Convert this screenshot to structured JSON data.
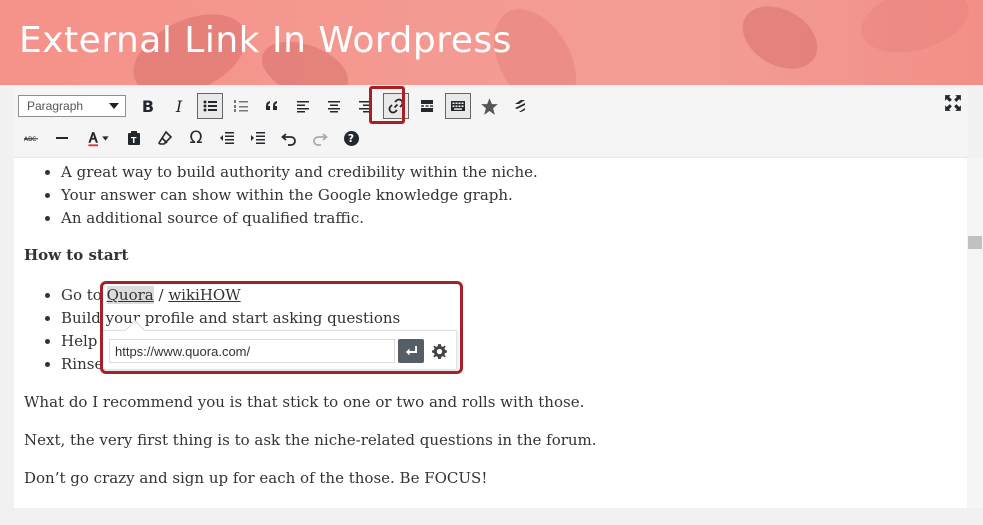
{
  "banner": {
    "title": "External Link In Wordpress"
  },
  "toolbar": {
    "format_select": "Paragraph",
    "row1_icons": [
      "bold-icon",
      "italic-icon",
      "bullet-list-icon",
      "numbered-list-icon",
      "blockquote-icon",
      "align-left-icon",
      "align-center-icon",
      "align-right-icon",
      "link-icon",
      "read-more-icon",
      "toolbar-toggle-icon",
      "star-icon",
      "plugin-icon"
    ],
    "row2_icons": [
      "strikethrough-icon",
      "horizontal-line-icon",
      "text-color-icon",
      "paste-text-icon",
      "clear-formatting-icon",
      "special-character-icon",
      "outdent-icon",
      "indent-icon",
      "undo-icon",
      "redo-icon",
      "help-icon"
    ],
    "bold": "B",
    "italic": "I",
    "omega": "Ω",
    "help": "?"
  },
  "content": {
    "list1": [
      "A great way to build authority and credibility within the niche.",
      "Your answer can show within the Google knowledge graph.",
      "An additional source of qualified traffic."
    ],
    "heading": "How to start",
    "list2": {
      "item1_prefix": "Go to ",
      "link_quora": "Quora",
      "separator": " / ",
      "link_wikihow": "wikiHOW",
      "item2": "Build your profile and start asking questions",
      "item3": "Help",
      "item4": "Rinse"
    },
    "para1": "What do I recommend you is that stick to one or two and rolls with those.",
    "para2": "Next, the very first thing is to ask the niche-related questions in the forum.",
    "para3": "Don’t go crazy and sign up for each of the those. Be FOCUS!"
  },
  "link_popover": {
    "url_value": "https://www.quora.com/"
  },
  "colors": {
    "banner": "#f4978f",
    "highlight": "#a81f27",
    "apply_button": "#555d66"
  }
}
